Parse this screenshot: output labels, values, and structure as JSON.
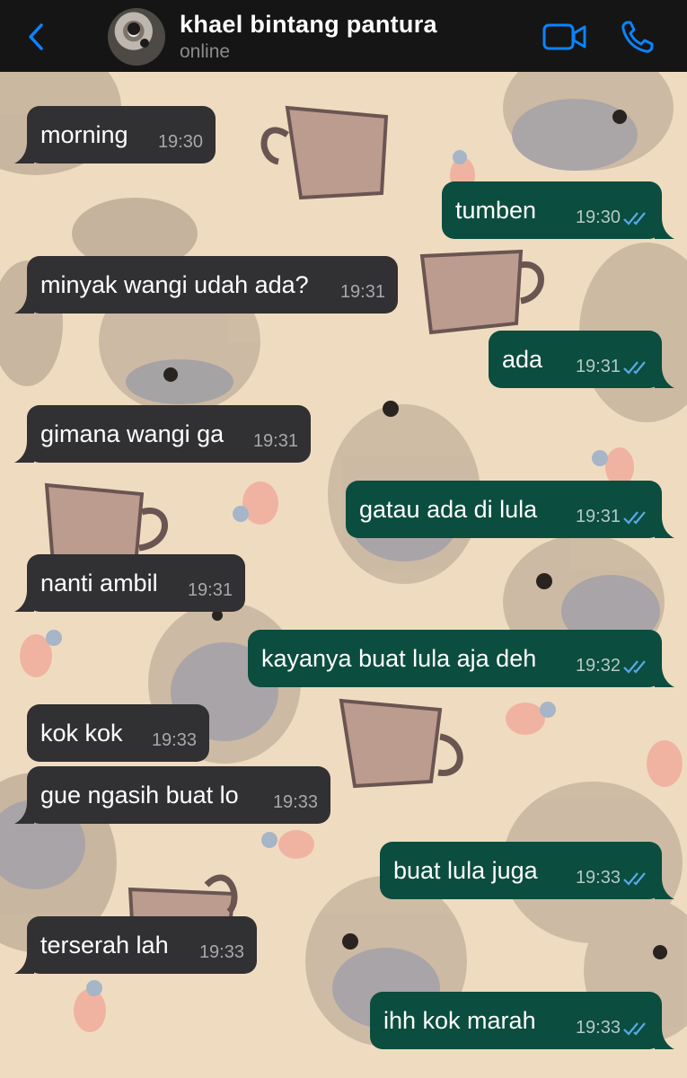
{
  "header": {
    "contact_name": "khael bintang pantura",
    "status": "online",
    "accent_color": "#0a84ff",
    "icons": [
      "chevron-left-icon",
      "video-camera-icon",
      "phone-icon"
    ]
  },
  "messages": [
    {
      "direction": "incoming",
      "text": "morning",
      "time": "19:30"
    },
    {
      "direction": "outgoing",
      "text": "tumben",
      "time": "19:30",
      "read": true
    },
    {
      "direction": "incoming",
      "text": "minyak wangi udah ada?",
      "time": "19:31"
    },
    {
      "direction": "outgoing",
      "text": "ada",
      "time": "19:31",
      "read": true
    },
    {
      "direction": "incoming",
      "text": "gimana wangi ga",
      "time": "19:31"
    },
    {
      "direction": "outgoing",
      "text": "gatau ada di lula",
      "time": "19:31",
      "read": true
    },
    {
      "direction": "incoming",
      "text": "nanti ambil",
      "time": "19:31"
    },
    {
      "direction": "outgoing",
      "text": "kayanya buat lula aja deh",
      "time": "19:32",
      "read": true
    },
    {
      "direction": "incoming",
      "text": "kok kok",
      "time": "19:33"
    },
    {
      "direction": "incoming",
      "text": "gue ngasih buat lo",
      "time": "19:33"
    },
    {
      "direction": "outgoing",
      "text": "buat lula juga",
      "time": "19:33",
      "read": true
    },
    {
      "direction": "incoming",
      "text": "terserah lah",
      "time": "19:33"
    },
    {
      "direction": "outgoing",
      "text": "ihh kok marah",
      "time": "19:33",
      "read": true
    }
  ],
  "colors": {
    "incoming_bubble": "#313033",
    "outgoing_bubble": "#0b4d3e",
    "read_ticks": "#5aa9e6",
    "wallpaper": "#efdcc0"
  }
}
